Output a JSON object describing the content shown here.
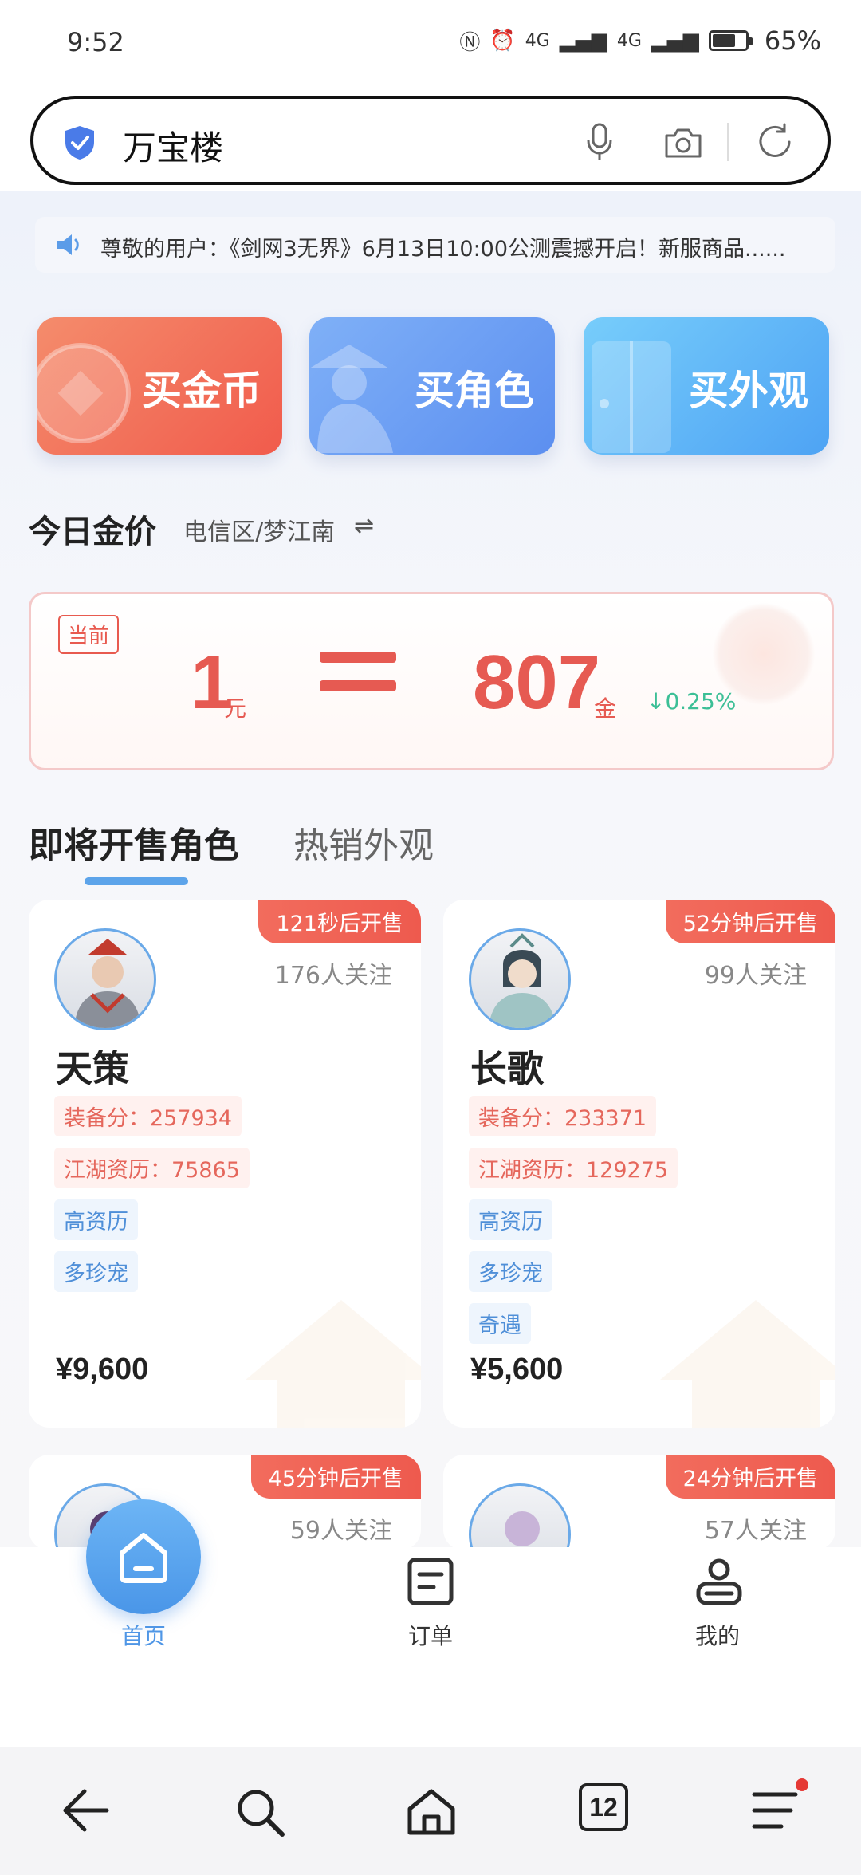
{
  "status_bar": {
    "time": "9:52",
    "signal_1": "4G",
    "signal_2": "4G",
    "battery": "65%",
    "battery_level": 0.65
  },
  "search": {
    "text": "万宝楼"
  },
  "notice": {
    "text": "尊敬的用户：《剑网3无界》6月13日10:00公测震撼开启！新服商品......"
  },
  "categories": [
    {
      "label": "买金币",
      "color": "#f15b4c"
    },
    {
      "label": "买角色",
      "color": "#5c8ff0"
    },
    {
      "label": "买外观",
      "color": "#4ea3f4"
    }
  ],
  "gold_price": {
    "title": "今日金价",
    "server": "电信区/梦江南",
    "swap_icon": "⇌",
    "tag": "当前",
    "yuan_value": "1",
    "yuan_unit": "元",
    "gold_value": "807",
    "gold_unit": "金",
    "change": "↓0.25%"
  },
  "tabs": [
    {
      "label": "即将开售角色",
      "active": true
    },
    {
      "label": "热销外观",
      "active": false
    }
  ],
  "roles": [
    {
      "badge": "121秒后开售",
      "follow": "176人关注",
      "name": "天策",
      "tags_red": [
        "装备分：257934",
        "江湖资历：75865"
      ],
      "tags_blue": [
        "高资历",
        "多珍宠"
      ],
      "price": "¥9,600"
    },
    {
      "badge": "52分钟后开售",
      "follow": "99人关注",
      "name": "长歌",
      "tags_red": [
        "装备分：233371",
        "江湖资历：129275"
      ],
      "tags_blue": [
        "高资历",
        "多珍宠",
        "奇遇"
      ],
      "price": "¥5,600"
    },
    {
      "badge": "45分钟后开售",
      "follow": "59人关注"
    },
    {
      "badge": "24分钟后开售",
      "follow": "57人关注"
    }
  ],
  "app_nav": [
    {
      "label": "首页",
      "icon": "home-icon",
      "active": true
    },
    {
      "label": "订单",
      "icon": "order-icon",
      "active": false
    },
    {
      "label": "我的",
      "icon": "profile-icon",
      "active": false
    }
  ],
  "browser_bar": {
    "tab_count": "12"
  },
  "colors": {
    "accent_red": "#e65a52",
    "accent_blue": "#4f96e6",
    "price_down": "#3cbf96"
  }
}
